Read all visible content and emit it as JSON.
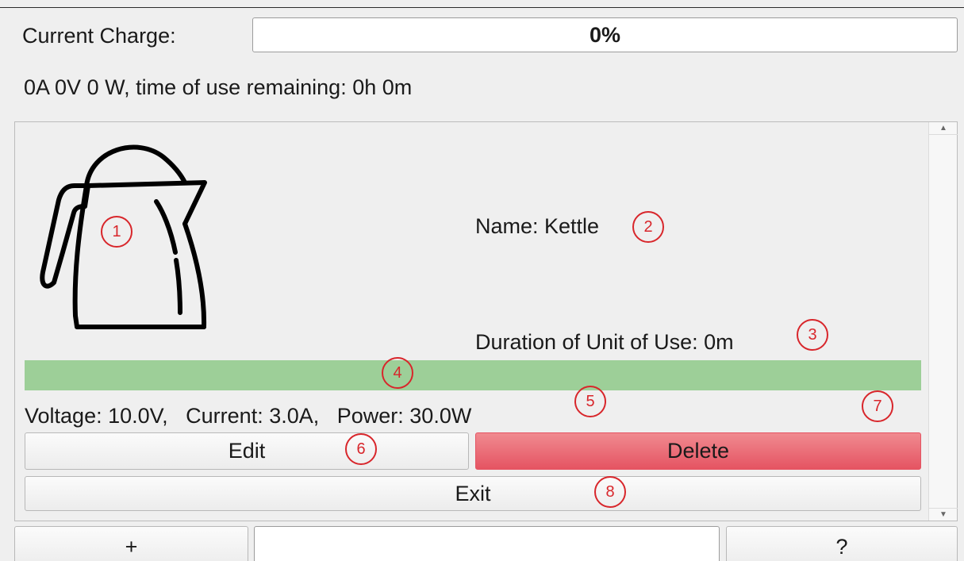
{
  "header": {
    "charge_label": "Current Charge:",
    "charge_text": "0%",
    "charge_fraction": 0,
    "status_line": "0A 0V 0 W, time of use remaining: 0h 0m"
  },
  "device": {
    "icon": "kettle-icon",
    "name_text": "Name: Kettle",
    "duration_text": "Duration of Unit of Use: 0m",
    "usage_bar_color": "#9dcf98",
    "specs_text": "Voltage: 10.0V,   Current: 3.0A,   Power: 30.0W"
  },
  "buttons": {
    "edit": "Edit",
    "delete": "Delete",
    "exit": "Exit",
    "add": "+",
    "help": "?"
  },
  "annotations": [
    "1",
    "2",
    "3",
    "4",
    "5",
    "6",
    "7",
    "8"
  ],
  "colors": {
    "danger": "#e55462",
    "annotation": "#d8262b"
  }
}
